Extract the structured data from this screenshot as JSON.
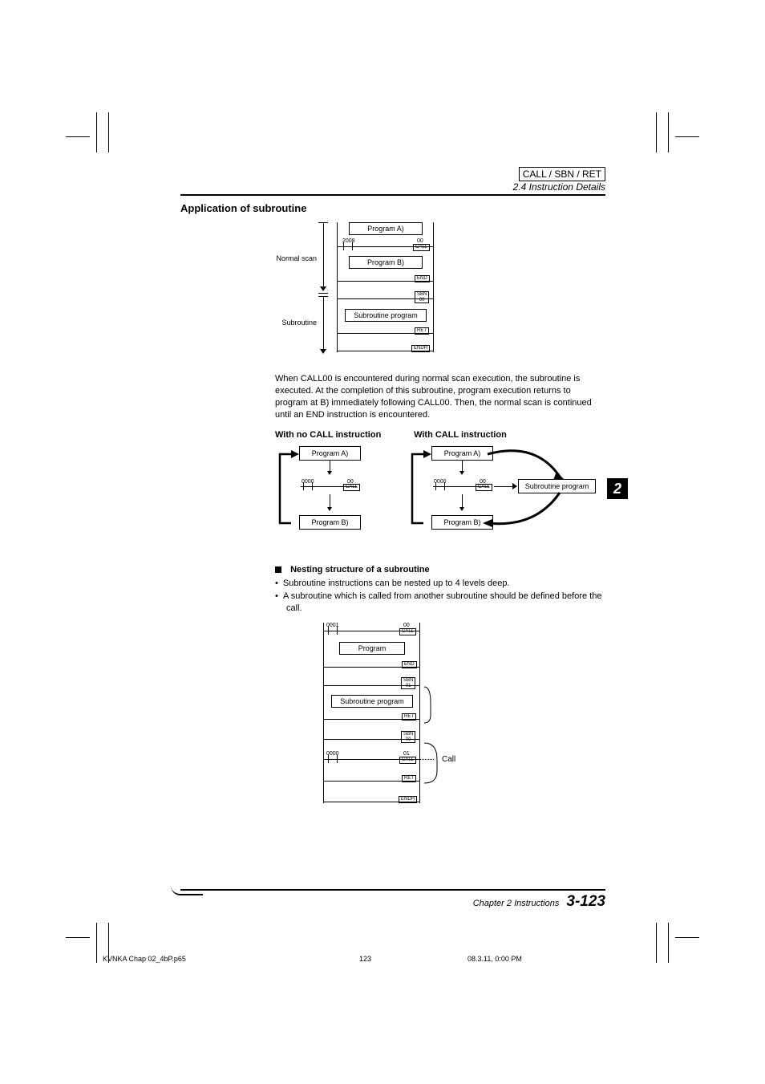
{
  "header": {
    "box": "CALL / SBN / RET",
    "section": "2.4 Instruction Details"
  },
  "title": "Application of subroutine",
  "diag1": {
    "normal_scan": "Normal scan",
    "subroutine": "Subroutine",
    "program_a": "Program   A)",
    "program_b": "Program   B)",
    "sub_prog": "Subroutine program",
    "c2008": "2008",
    "c00": "00",
    "call": "CALL",
    "end": "END",
    "sbn": "SBN",
    "ret": "RET",
    "endh": "ENDH"
  },
  "paragraph": "When CALL00 is encountered during normal scan execution, the subroutine is executed. At the completion of this subroutine, program execution returns to program at B) immediately following CALL00. Then, the normal scan is continued until an END instruction is encountered.",
  "col_heads": {
    "left": "With no CALL instruction",
    "right": "With CALL instruction"
  },
  "diag2": {
    "program_a": "Program   A)",
    "program_b": "Program   B)",
    "sub_prog": "Subroutine program",
    "c0000": "0000",
    "c00": "00",
    "call": "CALL"
  },
  "tab": "2",
  "nest": {
    "title": "Nesting structure of a subroutine",
    "b1": "Subroutine instructions can be nested up to 4 levels deep.",
    "b2": "A subroutine which is called from another subroutine should be defined before the call."
  },
  "diag3": {
    "program": "Program",
    "sub_prog": "Subroutine program",
    "c0001": "0001",
    "c0000": "0000",
    "c00": "00",
    "c01": "01",
    "call": "CALL",
    "end": "END",
    "sbn": "SBN",
    "ret": "RET",
    "endh": "ENDH",
    "call_label": "Call"
  },
  "footer": {
    "chapter": "Chapter 2   Instructions",
    "page": "3-123"
  },
  "meta": {
    "file": "KVNKA Chap 02_4bP.p65",
    "page": "123",
    "date": "08.3.11, 0:00 PM"
  }
}
